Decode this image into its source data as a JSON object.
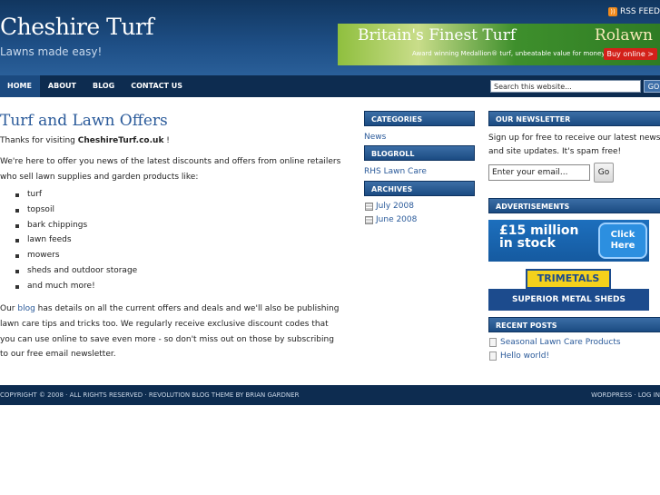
{
  "header": {
    "site_title": "Cheshire Turf",
    "tagline": "Lawns made easy!",
    "rss_label": "RSS FEED",
    "banner": {
      "title": "Britain's Finest Turf",
      "brand": "Rolawn",
      "strapline": "Award winning Medallion® turf, unbeatable value for money",
      "button": "Buy online >"
    }
  },
  "nav": {
    "items": [
      "HOME",
      "ABOUT",
      "BLOG",
      "CONTACT US"
    ],
    "search_placeholder": "Search this website...",
    "search_button": "GO"
  },
  "post": {
    "title": "Turf and Lawn Offers",
    "intro_prefix": "Thanks for visiting ",
    "intro_bold": "CheshireTurf.co.uk",
    "intro_suffix": " !",
    "para1": "We're here to offer you news of the latest discounts and offers from online retailers who sell lawn supplies and garden products like:",
    "list": [
      "turf",
      "topsoil",
      "bark chippings",
      "lawn feeds",
      "mowers",
      "sheds and outdoor storage",
      "and much more!"
    ],
    "para2_prefix": "Our ",
    "para2_link": "blog",
    "para2_suffix": " has details on all the current offers and deals and we'll also be publishing lawn care tips and tricks too. We regularly receive exclusive discount codes that you can use online to save even more - so don't miss out on those by subscribing to our free email newsletter."
  },
  "sidebar_left": {
    "categories_title": "CATEGORIES",
    "categories": [
      "News"
    ],
    "blogroll_title": "BLOGROLL",
    "blogroll": [
      "RHS Lawn Care"
    ],
    "archives_title": "ARCHIVES",
    "archives": [
      "July 2008",
      "June 2008"
    ]
  },
  "sidebar_right": {
    "newsletter_title": "OUR NEWSLETTER",
    "newsletter_text": "Sign up for free to receive our latest news and site updates. It's spam free!",
    "email_placeholder": "Enter your email...",
    "newsletter_button": "Go",
    "ads_title": "ADVERTISEMENTS",
    "ad1_line1": "£15 million",
    "ad1_line2": "in stock",
    "ad1_button": "Click Here",
    "ad2_logo": "TRIMETALS",
    "ad2_text": "SUPERIOR METAL SHEDS",
    "recent_title": "RECENT POSTS",
    "recent": [
      "Seasonal Lawn Care Products",
      "Hello world!"
    ]
  },
  "footer": {
    "left": "COPYRIGHT © 2008 · ALL RIGHTS RESERVED · REVOLUTION BLOG THEME BY BRIAN GARDNER",
    "right": "WORDPRESS · LOG IN"
  }
}
